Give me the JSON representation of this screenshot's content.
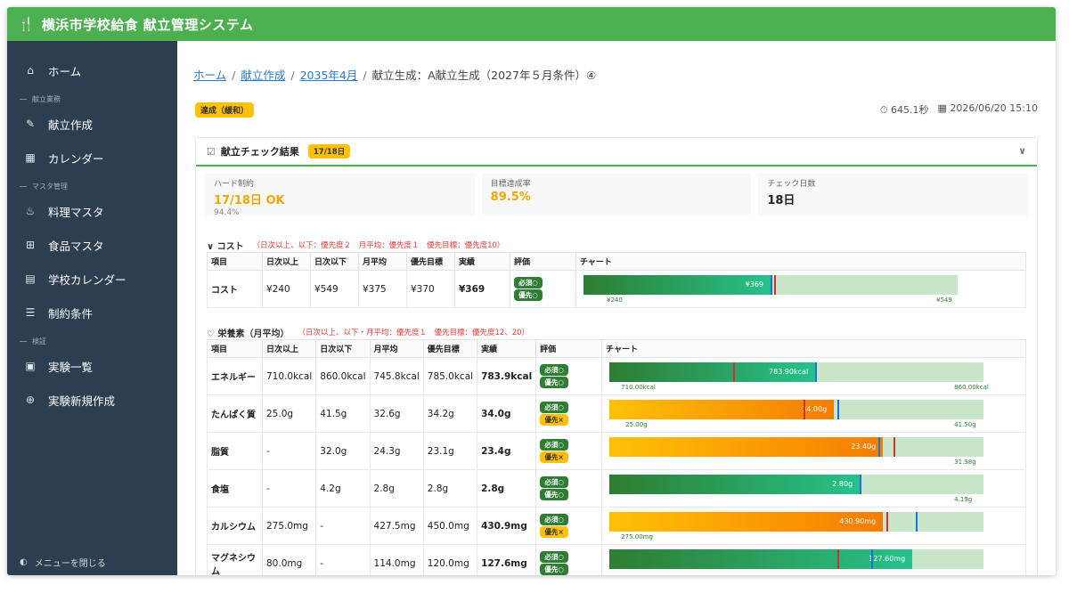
{
  "app": {
    "title": "横浜市学校給食 献立管理システム"
  },
  "sidebar": {
    "home": "ホーム",
    "sec_menu": "献立業務",
    "menu_create": "献立作成",
    "calendar": "カレンダー",
    "sec_master": "マスタ管理",
    "dish_master": "料理マスタ",
    "food_master": "食品マスタ",
    "school_calendar": "学校カレンダー",
    "constraints": "制約条件",
    "sec_verify": "検証",
    "experiments": "実験一覧",
    "new_experiment": "実験新規作成",
    "close_menu": "メニューを閉じる"
  },
  "breadcrumb": {
    "home": "ホーム",
    "menu_create": "献立作成",
    "month": "2035年4月",
    "current": "献立生成：A献立生成（2027年５月条件）④"
  },
  "status": {
    "badge": "達成（緩和）",
    "duration": "645.1秒",
    "datetime": "2026/06/20 15:10"
  },
  "panel": {
    "title": "献立チェック結果",
    "badge": "17/18日",
    "stats": {
      "hard_label": "ハード制約",
      "hard_value": "17/18日 OK",
      "hard_sub": "94.4%",
      "target_label": "目標達成率",
      "target_value": "89.5%",
      "days_label": "チェック日数",
      "days_value": "18日"
    }
  },
  "headers": [
    "項目",
    "日次以上",
    "日次以下",
    "月平均",
    "優先目標",
    "実績",
    "評価",
    "チャート"
  ],
  "cost": {
    "title": "∨ コスト",
    "note": "（日次以上、以下：優先度２　月平均：優先度１　優先目標：優先度10）",
    "rows": [
      {
        "name": "コスト",
        "min": "¥240",
        "max": "¥549",
        "avg": "¥375",
        "target": "¥370",
        "actual": "¥369",
        "evals": [
          {
            "t": "必須○",
            "c": "g"
          },
          {
            "t": "優先○",
            "c": "g"
          }
        ],
        "bar": {
          "color": "green",
          "fill": 0.5,
          "label": "¥369",
          "red": [
            0.51
          ],
          "blue": [
            0.5
          ],
          "ticks": [
            {
              "t": "¥240",
              "at": 0.1
            },
            {
              "t": "¥549",
              "at": 0.98
            }
          ]
        }
      }
    ]
  },
  "nutrition": {
    "title": "♡ 栄養素（月平均）",
    "note": "（日次以上、以下・月平均：優先度１　優先目標：優先度12、20）",
    "rows": [
      {
        "name": "エネルギー",
        "min": "710.0kcal",
        "max": "860.0kcal",
        "avg": "745.8kcal",
        "target": "785.0kcal",
        "actual": "783.9kcal",
        "evals": [
          {
            "t": "必須○",
            "c": "g"
          },
          {
            "t": "優先○",
            "c": "g"
          }
        ],
        "bar": {
          "color": "green",
          "fill": 0.55,
          "label": "783.90kcal",
          "red": [
            0.33
          ],
          "blue": [
            0.55
          ],
          "ticks": [
            {
              "t": "710.00kcal",
              "at": 0.07
            },
            {
              "t": "860.00kcal",
              "at": 0.96
            }
          ]
        }
      },
      {
        "name": "たんぱく質",
        "min": "25.0g",
        "max": "41.5g",
        "avg": "32.6g",
        "target": "34.2g",
        "actual": "34.0g",
        "evals": [
          {
            "t": "必須○",
            "c": "g"
          },
          {
            "t": "優先×",
            "c": "y"
          }
        ],
        "bar": {
          "color": "orange",
          "fill": 0.6,
          "label": "34.00g",
          "red": [
            0.52
          ],
          "blue": [
            0.61
          ],
          "ticks": [
            {
              "t": "25.00g",
              "at": 0.08
            },
            {
              "t": "41.50g",
              "at": 0.96
            }
          ]
        }
      },
      {
        "name": "脂質",
        "min": "-",
        "max": "32.0g",
        "avg": "24.3g",
        "target": "23.1g",
        "actual": "23.4g",
        "evals": [
          {
            "t": "必須○",
            "c": "g"
          },
          {
            "t": "優先×",
            "c": "y"
          }
        ],
        "bar": {
          "color": "orange",
          "fill": 0.73,
          "label": "23.40g",
          "red": [
            0.76
          ],
          "blue": [
            0.72
          ],
          "ticks": [
            {
              "t": "31.98g",
              "at": 0.96
            }
          ]
        }
      },
      {
        "name": "食塩",
        "min": "-",
        "max": "4.2g",
        "avg": "2.8g",
        "target": "2.8g",
        "actual": "2.8g",
        "evals": [
          {
            "t": "必須○",
            "c": "g"
          },
          {
            "t": "優先○",
            "c": "g"
          }
        ],
        "bar": {
          "color": "green",
          "fill": 0.67,
          "label": "2.80g",
          "red": [],
          "blue": [
            0.67
          ],
          "ticks": [
            {
              "t": "4.19g",
              "at": 0.96
            }
          ]
        }
      },
      {
        "name": "カルシウム",
        "min": "275.0mg",
        "max": "-",
        "avg": "427.5mg",
        "target": "450.0mg",
        "actual": "430.9mg",
        "evals": [
          {
            "t": "必須○",
            "c": "g"
          },
          {
            "t": "優先×",
            "c": "y"
          }
        ],
        "bar": {
          "color": "orange",
          "fill": 0.73,
          "label": "430.90mg",
          "red": [
            0.74
          ],
          "blue": [
            0.82
          ],
          "ticks": [
            {
              "t": "275.00mg",
              "at": 0.07
            }
          ]
        }
      },
      {
        "name": "マグネシウム",
        "min": "80.0mg",
        "max": "-",
        "avg": "114.0mg",
        "target": "120.0mg",
        "actual": "127.6mg",
        "evals": [
          {
            "t": "必須○",
            "c": "g"
          },
          {
            "t": "優先○",
            "c": "g"
          }
        ],
        "bar": {
          "color": "green",
          "fill": 0.81,
          "label": "127.60mg",
          "red": [
            0.61
          ],
          "blue": [
            0.7
          ],
          "ticks": []
        }
      }
    ]
  }
}
